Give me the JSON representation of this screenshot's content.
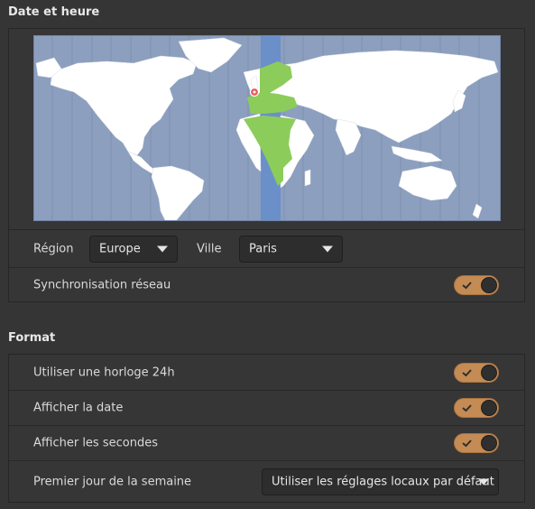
{
  "datetime": {
    "title": "Date et heure",
    "region_label": "Région",
    "region_value": "Europe",
    "city_label": "Ville",
    "city_value": "Paris",
    "sync_label": "Synchronisation réseau",
    "sync_on": true
  },
  "format": {
    "title": "Format",
    "clock24_label": "Utiliser une horloge 24h",
    "show_date_label": "Afficher la date",
    "show_seconds_label": "Afficher les secondes",
    "first_day_label": "Premier jour de la semaine",
    "first_day_value": "Utiliser les réglages locaux par défaut"
  },
  "colors": {
    "accent": "#c58b54",
    "map_ocean": "#8c9fbe",
    "map_land": "#ffffff",
    "timezone_band": "#6a8fc9",
    "selected_zone": "#8ccc5a",
    "location_pin": "#e8595a"
  }
}
